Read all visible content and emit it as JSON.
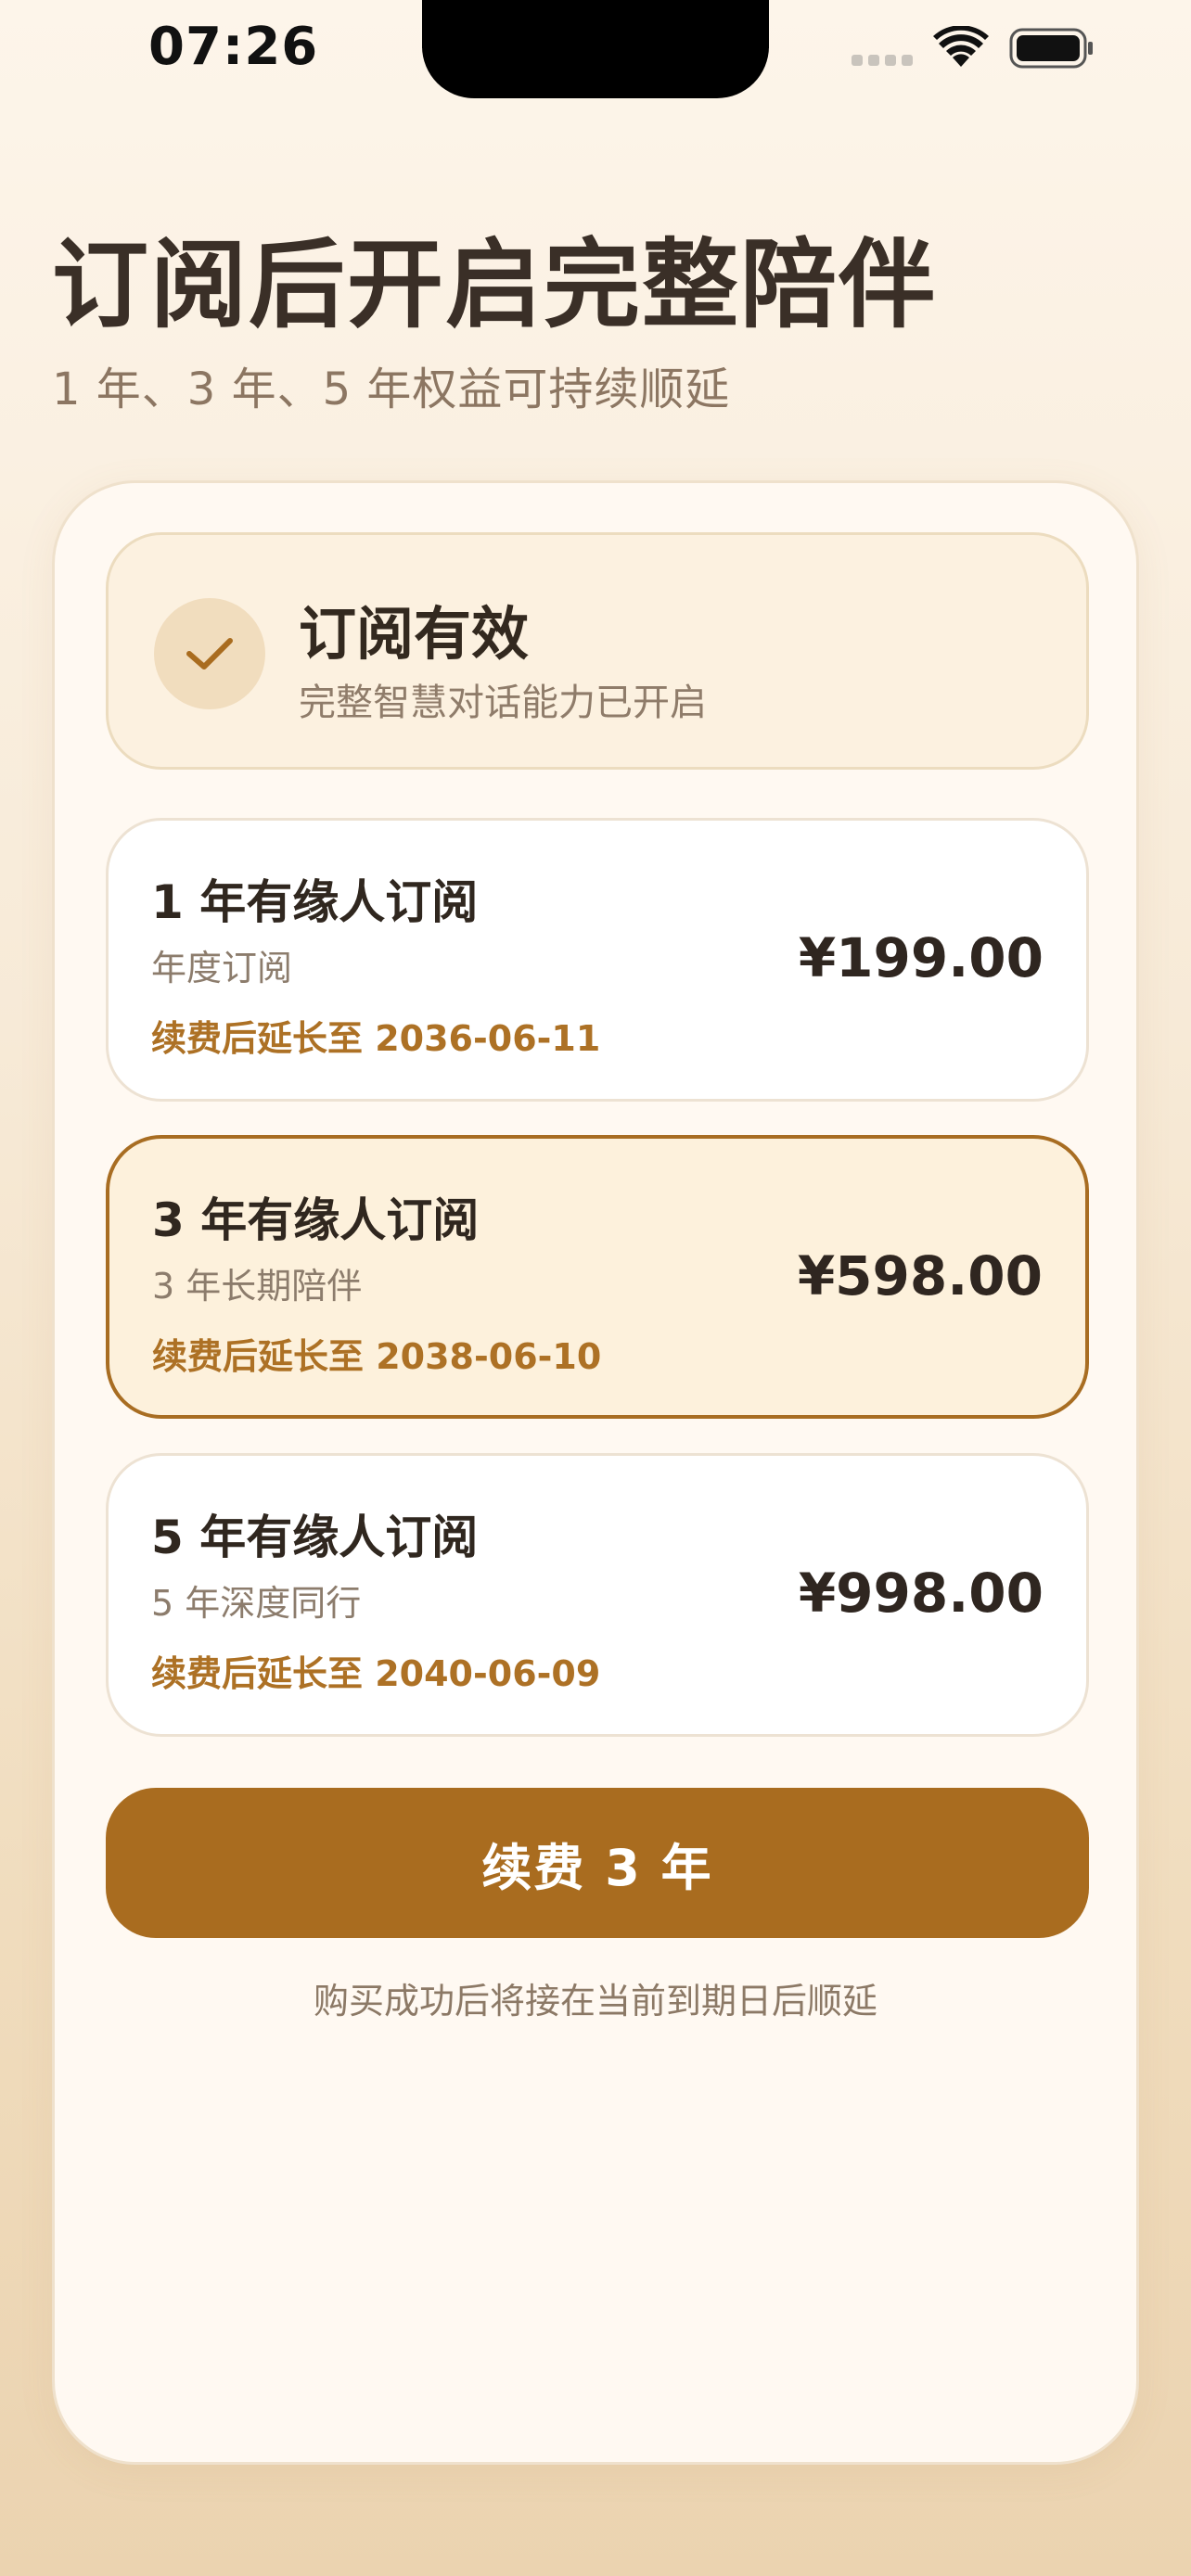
{
  "status_bar": {
    "time": "07:26"
  },
  "header": {
    "title": "订阅后开启完整陪伴",
    "subtitle": "1 年、3 年、5 年权益可持续顺延"
  },
  "subscription_status": {
    "title": "订阅有效",
    "description": "完整智慧对话能力已开启",
    "icon": "check-icon"
  },
  "plans": [
    {
      "name": "1 年有缘人订阅",
      "description": "年度订阅",
      "renewal": "续费后延长至 2036-06-11",
      "price": "¥199.00",
      "selected": false
    },
    {
      "name": "3 年有缘人订阅",
      "description": "3 年长期陪伴",
      "renewal": "续费后延长至 2038-06-10",
      "price": "¥598.00",
      "selected": true
    },
    {
      "name": "5 年有缘人订阅",
      "description": "5 年深度同行",
      "renewal": "续费后延长至 2040-06-09",
      "price": "¥998.00",
      "selected": false
    }
  ],
  "cta": {
    "label": "续费 3 年"
  },
  "footnote": "购买成功后将接在当前到期日后顺延",
  "colors": {
    "accent": "#a96c1f",
    "accent_text": "#ad7125",
    "selected_bg": "#fdf1dc"
  }
}
